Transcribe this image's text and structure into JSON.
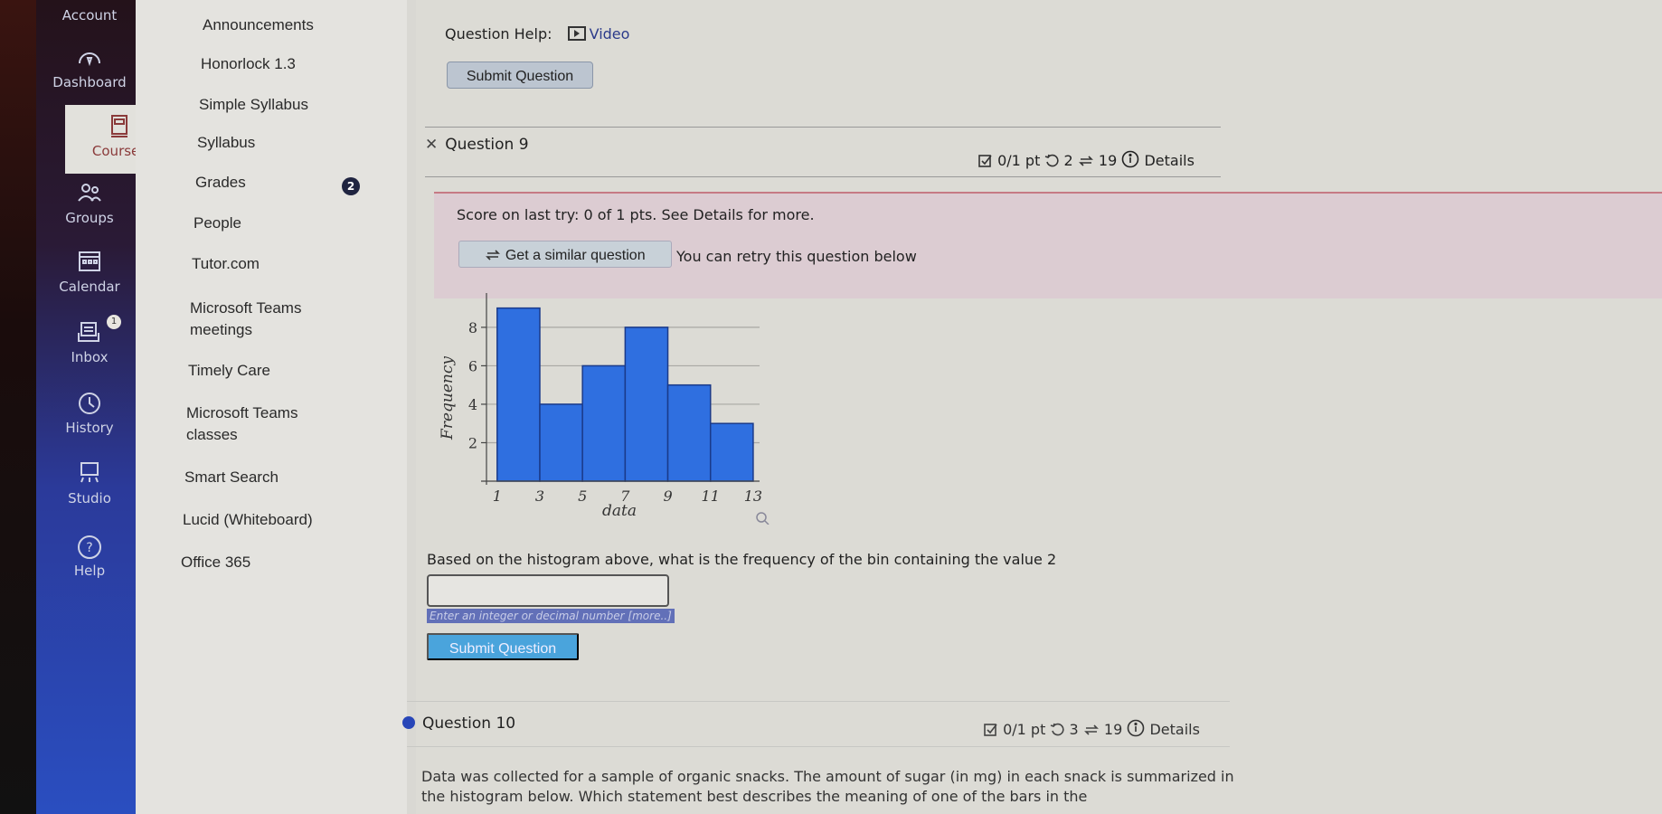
{
  "global_nav": {
    "items": [
      {
        "label": "Account",
        "icon": "account-icon"
      },
      {
        "label": "Dashboard",
        "icon": "dashboard-icon"
      },
      {
        "label": "Courses",
        "icon": "courses-icon",
        "active": true
      },
      {
        "label": "Groups",
        "icon": "groups-icon"
      },
      {
        "label": "Calendar",
        "icon": "calendar-icon"
      },
      {
        "label": "Inbox",
        "icon": "inbox-icon",
        "badge": "1"
      },
      {
        "label": "History",
        "icon": "history-icon"
      },
      {
        "label": "Studio",
        "icon": "studio-icon"
      },
      {
        "label": "Help",
        "icon": "help-icon"
      }
    ]
  },
  "course_nav": {
    "items": [
      {
        "label": "Announcements"
      },
      {
        "label": "Honorlock 1.3"
      },
      {
        "label": "Simple Syllabus"
      },
      {
        "label": "Syllabus"
      },
      {
        "label": "Grades",
        "badge": "2"
      },
      {
        "label": "People"
      },
      {
        "label": "Tutor.com"
      },
      {
        "label": "Microsoft Teams meetings"
      },
      {
        "label": "Timely Care"
      },
      {
        "label": "Microsoft Teams classes"
      },
      {
        "label": "Smart Search"
      },
      {
        "label": "Lucid (Whiteboard)"
      },
      {
        "label": "Office 365"
      }
    ]
  },
  "prev_question": {
    "help_label": "Question Help:",
    "video_label": "Video",
    "submit_label": "Submit Question"
  },
  "question9": {
    "title": "Question 9",
    "status_icon": "x-icon",
    "points": "0/1 pt",
    "retries": "2",
    "versions": "19",
    "details_label": "Details",
    "score_text": "Score on last try: 0 of 1 pts. See Details for more.",
    "similar_label": "Get a similar question",
    "retry_text": "You can retry this question below",
    "prompt": "Based on the histogram above, what is the frequency of the bin containing the value 2",
    "answer_value": "",
    "hint": "Enter an integer or decimal number [more..]",
    "submit_label": "Submit Question"
  },
  "question10": {
    "title": "Question 10",
    "points": "0/1 pt",
    "retries": "3",
    "versions": "19",
    "details_label": "Details",
    "text": "Data was collected for a sample of organic snacks. The amount of sugar (in mg) in each snack is summarized in the histogram below. Which statement best describes the meaning of one of the bars in the"
  },
  "colors": {
    "bar": "#2f6fe0",
    "bar_edge": "#1a3a8a",
    "accent": "#4aa4dc"
  },
  "chart_data": {
    "type": "bar",
    "title": "",
    "xlabel": "data",
    "ylabel": "Frequency",
    "bin_edges": [
      1,
      3,
      5,
      7,
      9,
      11,
      13
    ],
    "categories": [
      "1-3",
      "3-5",
      "5-7",
      "7-9",
      "9-11",
      "11-13"
    ],
    "values": [
      9,
      4,
      6,
      8,
      5,
      3
    ],
    "xticks": [
      "1",
      "3",
      "5",
      "7",
      "9",
      "11",
      "13"
    ],
    "yticks": [
      "2",
      "4",
      "6",
      "8"
    ],
    "ylim": [
      0,
      9.5
    ],
    "xlim": [
      0.5,
      13.3
    ],
    "grid": true
  }
}
